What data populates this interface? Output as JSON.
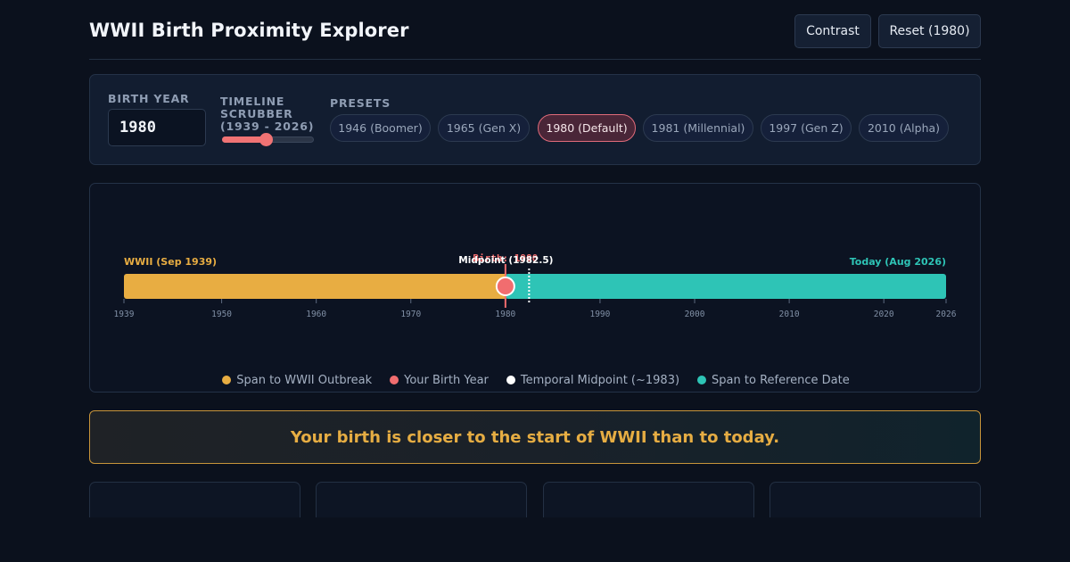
{
  "header": {
    "title": "WWII Birth Proximity Explorer",
    "contrast_label": "Contrast",
    "reset_label": "Reset (1980)"
  },
  "controls": {
    "birth_year_label": "BIRTH YEAR",
    "birth_year_value": "1980",
    "scrubber_label_line1": "TIMELINE",
    "scrubber_label_line2": "SCRUBBER",
    "scrubber_label_line3": "(1939 - 2026)",
    "scrubber": {
      "min": 1939,
      "max": 2026,
      "value": 1980
    },
    "presets_label": "PRESETS",
    "presets": [
      {
        "label": "1946 (Boomer)",
        "active": false
      },
      {
        "label": "1965 (Gen X)",
        "active": false
      },
      {
        "label": "1980 (Default)",
        "active": true
      },
      {
        "label": "1981 (Millennial)",
        "active": false
      },
      {
        "label": "1997 (Gen Z)",
        "active": false
      },
      {
        "label": "2010 (Alpha)",
        "active": false
      }
    ]
  },
  "timeline": {
    "start_label": "WWII (Sep 1939)",
    "end_label": "Today (Aug 2026)",
    "birth_label": "Birth: 1980",
    "midpoint_label": "Midpoint (1982.5)",
    "start_year": 1939.67,
    "end_year": 2026.58,
    "birth_year": 1980,
    "midpoint_year": 1982.5,
    "ticks": [
      1939,
      1950,
      1960,
      1970,
      1980,
      1990,
      2000,
      2010,
      2020,
      2026
    ],
    "colors": {
      "past": "#e8ad42",
      "future": "#2ec4b6",
      "birth": "#f16d6f",
      "midpoint": "#ffffff"
    }
  },
  "legend": [
    {
      "label": "Span to WWII Outbreak",
      "color": "#e8ad42"
    },
    {
      "label": "Your Birth Year",
      "color": "#f16d6f"
    },
    {
      "label": "Temporal Midpoint (~1983)",
      "color": "#ffffff"
    },
    {
      "label": "Span to Reference Date",
      "color": "#2ec4b6"
    }
  ],
  "result": {
    "message": "Your birth is closer to the start of WWII than to today."
  }
}
